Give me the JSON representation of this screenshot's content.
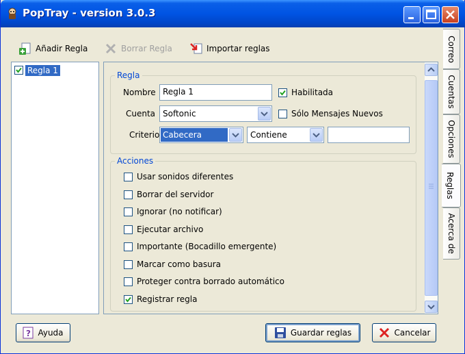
{
  "window": {
    "title": "PopTray - version 3.0.3"
  },
  "side_tabs": [
    {
      "label": "Correo",
      "active": false
    },
    {
      "label": "Cuentas",
      "active": false
    },
    {
      "label": "Opciones",
      "active": false
    },
    {
      "label": "Reglas",
      "active": true
    },
    {
      "label": "Acerca de",
      "active": false
    }
  ],
  "toolbar": {
    "add_rule": "Añadir Regla",
    "delete_rule": "Borrar Regla",
    "import_rules": "Importar reglas"
  },
  "rules_list": [
    {
      "label": "Regla 1",
      "checked": true,
      "selected": true
    }
  ],
  "rule_group": {
    "title": "Regla",
    "name_label": "Nombre",
    "name_value": "Regla 1",
    "enabled_label": "Habilitada",
    "enabled_checked": true,
    "account_label": "Cuenta",
    "account_value": "Softonic",
    "new_only_label": "Sólo Mensajes Nuevos",
    "new_only_checked": false,
    "criteria_label": "Criterio",
    "criteria_field": "Cabecera",
    "criteria_operator": "Contiene",
    "criteria_value": ""
  },
  "actions_group": {
    "title": "Acciones",
    "items": [
      {
        "label": "Usar sonidos diferentes",
        "checked": false
      },
      {
        "label": "Borrar del servidor",
        "checked": false
      },
      {
        "label": "Ignorar (no notificar)",
        "checked": false
      },
      {
        "label": "Ejecutar archivo",
        "checked": false
      },
      {
        "label": "Importante (Bocadillo emergente)",
        "checked": false
      },
      {
        "label": "Marcar como basura",
        "checked": false
      },
      {
        "label": "Proteger contra borrado automático",
        "checked": false
      },
      {
        "label": "Registrar regla",
        "checked": true
      }
    ]
  },
  "footer": {
    "help": "Ayuda",
    "save": "Guardar reglas",
    "cancel": "Cancelar"
  },
  "colors": {
    "title_bar": "#0054e3",
    "selection": "#316ac5",
    "group_title": "#0046d5",
    "face": "#ece9d8"
  },
  "icons": [
    "app-icon",
    "minimize-icon",
    "maximize-icon",
    "close-icon",
    "add-rule-icon",
    "delete-rule-icon",
    "import-rules-icon",
    "help-icon",
    "save-icon",
    "cancel-icon",
    "check-icon",
    "dropdown-arrow-icon",
    "scroll-up-icon",
    "scroll-down-icon"
  ]
}
